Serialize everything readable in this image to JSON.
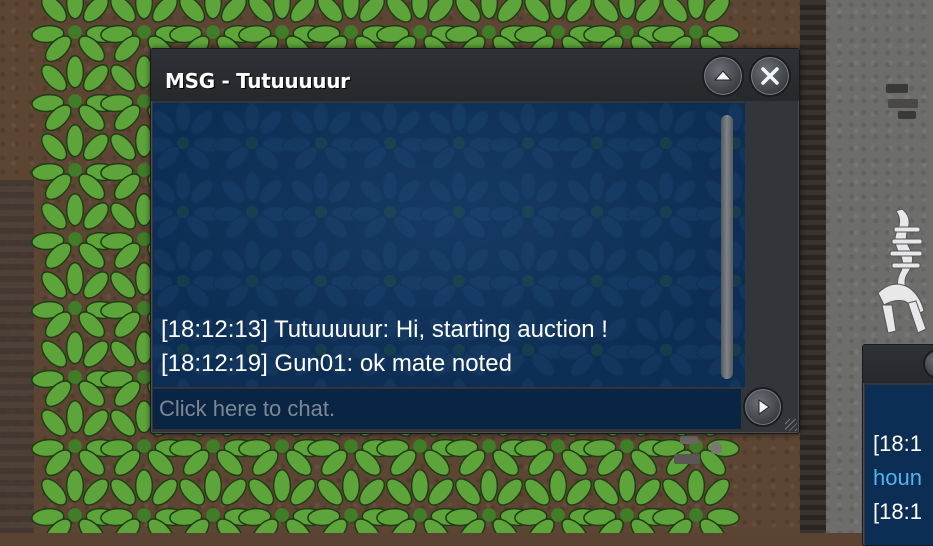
{
  "message_window": {
    "title": "MSG - Tutuuuuur",
    "collapse_icon": "chevron-up-icon",
    "close_icon": "close-icon",
    "send_icon": "play-arrow-icon",
    "messages": [
      {
        "text": "[18:12:13] Tutuuuuur: Hi, starting auction !"
      },
      {
        "text": "[18:12:19] Gun01: ok mate noted"
      }
    ],
    "input": {
      "value": "",
      "placeholder": "Click here to chat."
    },
    "colors": {
      "chat_background": "#0d2e54",
      "frame": "#323539",
      "text": "#ffffff",
      "placeholder": "#7c8794"
    }
  },
  "secondary_window": {
    "lines": [
      {
        "text": "[18:1",
        "kind": "time"
      },
      {
        "text": "houn",
        "kind": "name"
      },
      {
        "text": "[18:1",
        "kind": "time"
      }
    ],
    "colors": {
      "name": "#4fb4f0"
    }
  },
  "world": {
    "terrain_left": "dirt",
    "terrain_right": "rock",
    "plant_color": "#5da53a"
  }
}
